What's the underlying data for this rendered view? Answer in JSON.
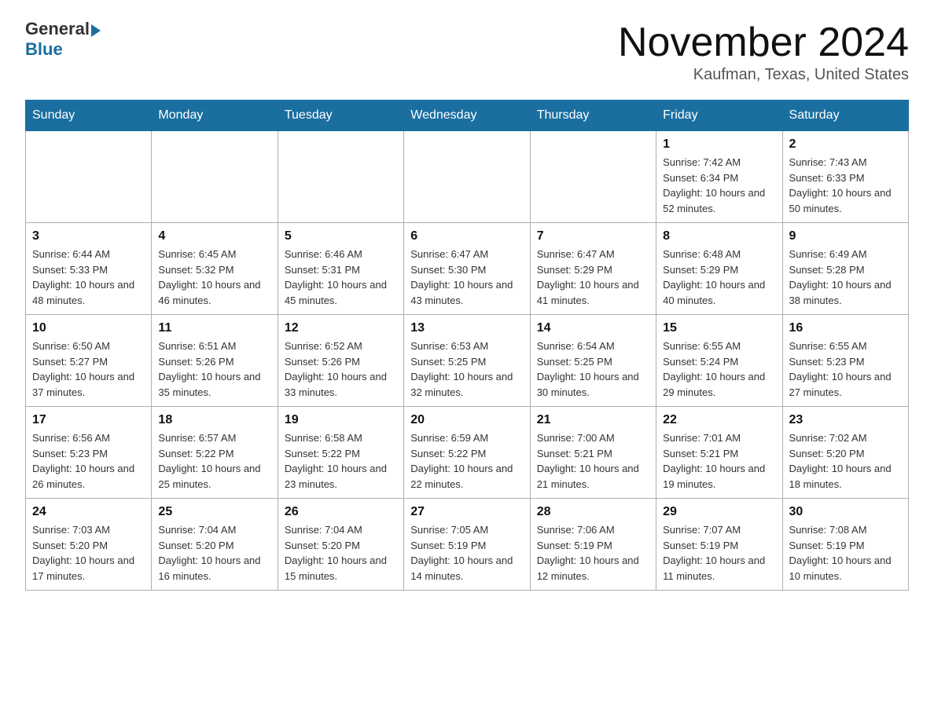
{
  "header": {
    "logo_general": "General",
    "logo_blue": "Blue",
    "title": "November 2024",
    "location": "Kaufman, Texas, United States"
  },
  "calendar": {
    "days_of_week": [
      "Sunday",
      "Monday",
      "Tuesday",
      "Wednesday",
      "Thursday",
      "Friday",
      "Saturday"
    ],
    "weeks": [
      [
        {
          "day": "",
          "info": ""
        },
        {
          "day": "",
          "info": ""
        },
        {
          "day": "",
          "info": ""
        },
        {
          "day": "",
          "info": ""
        },
        {
          "day": "",
          "info": ""
        },
        {
          "day": "1",
          "info": "Sunrise: 7:42 AM\nSunset: 6:34 PM\nDaylight: 10 hours and 52 minutes."
        },
        {
          "day": "2",
          "info": "Sunrise: 7:43 AM\nSunset: 6:33 PM\nDaylight: 10 hours and 50 minutes."
        }
      ],
      [
        {
          "day": "3",
          "info": "Sunrise: 6:44 AM\nSunset: 5:33 PM\nDaylight: 10 hours and 48 minutes."
        },
        {
          "day": "4",
          "info": "Sunrise: 6:45 AM\nSunset: 5:32 PM\nDaylight: 10 hours and 46 minutes."
        },
        {
          "day": "5",
          "info": "Sunrise: 6:46 AM\nSunset: 5:31 PM\nDaylight: 10 hours and 45 minutes."
        },
        {
          "day": "6",
          "info": "Sunrise: 6:47 AM\nSunset: 5:30 PM\nDaylight: 10 hours and 43 minutes."
        },
        {
          "day": "7",
          "info": "Sunrise: 6:47 AM\nSunset: 5:29 PM\nDaylight: 10 hours and 41 minutes."
        },
        {
          "day": "8",
          "info": "Sunrise: 6:48 AM\nSunset: 5:29 PM\nDaylight: 10 hours and 40 minutes."
        },
        {
          "day": "9",
          "info": "Sunrise: 6:49 AM\nSunset: 5:28 PM\nDaylight: 10 hours and 38 minutes."
        }
      ],
      [
        {
          "day": "10",
          "info": "Sunrise: 6:50 AM\nSunset: 5:27 PM\nDaylight: 10 hours and 37 minutes."
        },
        {
          "day": "11",
          "info": "Sunrise: 6:51 AM\nSunset: 5:26 PM\nDaylight: 10 hours and 35 minutes."
        },
        {
          "day": "12",
          "info": "Sunrise: 6:52 AM\nSunset: 5:26 PM\nDaylight: 10 hours and 33 minutes."
        },
        {
          "day": "13",
          "info": "Sunrise: 6:53 AM\nSunset: 5:25 PM\nDaylight: 10 hours and 32 minutes."
        },
        {
          "day": "14",
          "info": "Sunrise: 6:54 AM\nSunset: 5:25 PM\nDaylight: 10 hours and 30 minutes."
        },
        {
          "day": "15",
          "info": "Sunrise: 6:55 AM\nSunset: 5:24 PM\nDaylight: 10 hours and 29 minutes."
        },
        {
          "day": "16",
          "info": "Sunrise: 6:55 AM\nSunset: 5:23 PM\nDaylight: 10 hours and 27 minutes."
        }
      ],
      [
        {
          "day": "17",
          "info": "Sunrise: 6:56 AM\nSunset: 5:23 PM\nDaylight: 10 hours and 26 minutes."
        },
        {
          "day": "18",
          "info": "Sunrise: 6:57 AM\nSunset: 5:22 PM\nDaylight: 10 hours and 25 minutes."
        },
        {
          "day": "19",
          "info": "Sunrise: 6:58 AM\nSunset: 5:22 PM\nDaylight: 10 hours and 23 minutes."
        },
        {
          "day": "20",
          "info": "Sunrise: 6:59 AM\nSunset: 5:22 PM\nDaylight: 10 hours and 22 minutes."
        },
        {
          "day": "21",
          "info": "Sunrise: 7:00 AM\nSunset: 5:21 PM\nDaylight: 10 hours and 21 minutes."
        },
        {
          "day": "22",
          "info": "Sunrise: 7:01 AM\nSunset: 5:21 PM\nDaylight: 10 hours and 19 minutes."
        },
        {
          "day": "23",
          "info": "Sunrise: 7:02 AM\nSunset: 5:20 PM\nDaylight: 10 hours and 18 minutes."
        }
      ],
      [
        {
          "day": "24",
          "info": "Sunrise: 7:03 AM\nSunset: 5:20 PM\nDaylight: 10 hours and 17 minutes."
        },
        {
          "day": "25",
          "info": "Sunrise: 7:04 AM\nSunset: 5:20 PM\nDaylight: 10 hours and 16 minutes."
        },
        {
          "day": "26",
          "info": "Sunrise: 7:04 AM\nSunset: 5:20 PM\nDaylight: 10 hours and 15 minutes."
        },
        {
          "day": "27",
          "info": "Sunrise: 7:05 AM\nSunset: 5:19 PM\nDaylight: 10 hours and 14 minutes."
        },
        {
          "day": "28",
          "info": "Sunrise: 7:06 AM\nSunset: 5:19 PM\nDaylight: 10 hours and 12 minutes."
        },
        {
          "day": "29",
          "info": "Sunrise: 7:07 AM\nSunset: 5:19 PM\nDaylight: 10 hours and 11 minutes."
        },
        {
          "day": "30",
          "info": "Sunrise: 7:08 AM\nSunset: 5:19 PM\nDaylight: 10 hours and 10 minutes."
        }
      ]
    ]
  }
}
